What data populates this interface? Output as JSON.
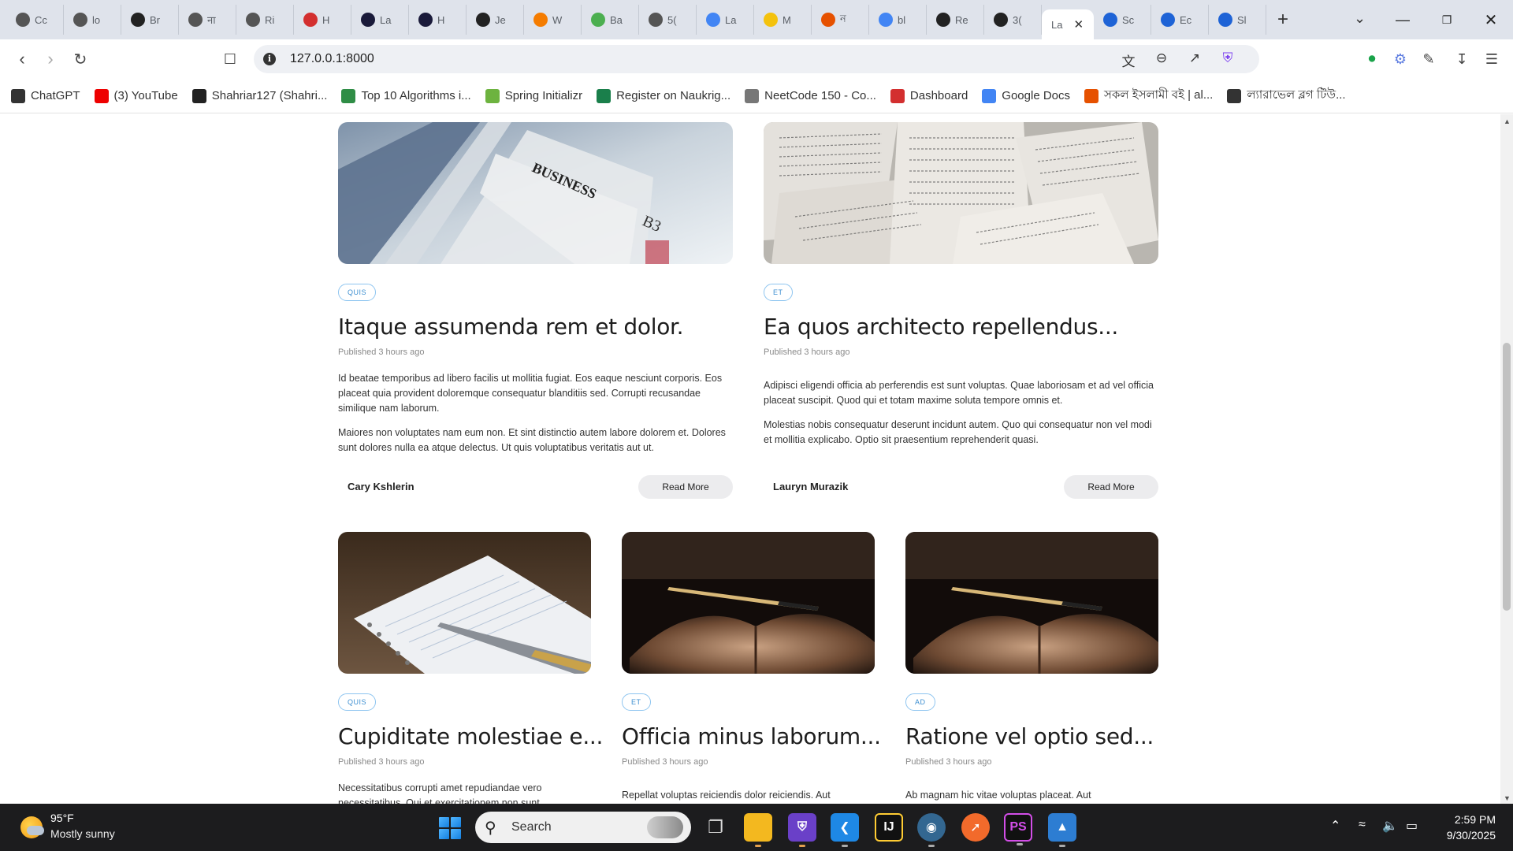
{
  "browser": {
    "tabs": [
      {
        "title": "Cc",
        "icon": "chatgpt-icon",
        "color": "#555"
      },
      {
        "title": "lo",
        "icon": "openai-icon",
        "color": "#555"
      },
      {
        "title": "Br",
        "icon": "github-icon",
        "color": "#222"
      },
      {
        "title": "ना",
        "icon": "chatgpt-icon",
        "color": "#555"
      },
      {
        "title": "Ri",
        "icon": "chatgpt-icon",
        "color": "#555"
      },
      {
        "title": "H",
        "icon": "nsu-icon",
        "color": "#d32f2f"
      },
      {
        "title": "La",
        "icon": "atcoder-icon",
        "color": "#1a1a3a"
      },
      {
        "title": "H",
        "icon": "atcoder-icon",
        "color": "#1a1a3a"
      },
      {
        "title": "Je",
        "icon": "github-icon",
        "color": "#222"
      },
      {
        "title": "W",
        "icon": "diamond-icon",
        "color": "#f57c00"
      },
      {
        "title": "Ba",
        "icon": "translate-icon",
        "color": "#4caf50"
      },
      {
        "title": "5(",
        "icon": "chatgpt-icon",
        "color": "#555"
      },
      {
        "title": "La",
        "icon": "docs-icon",
        "color": "#4285f4"
      },
      {
        "title": "M",
        "icon": "coin-icon",
        "color": "#f4c20d"
      },
      {
        "title": "ন",
        "icon": "a-icon",
        "color": "#e65100"
      },
      {
        "title": "bl",
        "icon": "google-icon",
        "color": "#4285f4"
      },
      {
        "title": "Re",
        "icon": "puzzle-icon",
        "color": "#222"
      },
      {
        "title": "3(",
        "icon": "is-icon",
        "color": "#222"
      },
      {
        "title": "La",
        "icon": "active-page-icon",
        "color": "#fff",
        "active": true
      },
      {
        "title": "Sc",
        "icon": "forms-icon",
        "color": "#1e63d6"
      },
      {
        "title": "Ec",
        "icon": "forms-icon",
        "color": "#1e63d6"
      },
      {
        "title": "Sl",
        "icon": "forms-icon",
        "color": "#1e63d6"
      }
    ],
    "url": "127.0.0.1:8000",
    "bookmarks": [
      {
        "label": "ChatGPT",
        "icon": "chatgpt-icon",
        "color": "#333"
      },
      {
        "label": "(3) YouTube",
        "icon": "youtube-icon",
        "color": "#e00"
      },
      {
        "label": "Shahriar127 (Shahri...",
        "icon": "github-icon",
        "color": "#222"
      },
      {
        "label": "Top 10 Algorithms i...",
        "icon": "gfg-icon",
        "color": "#2f8d46"
      },
      {
        "label": "Spring Initializr",
        "icon": "spring-icon",
        "color": "#6db33f"
      },
      {
        "label": "Register on Naukrig...",
        "icon": "naukri-icon",
        "color": "#1a7f4b"
      },
      {
        "label": "NeetCode 150 - Co...",
        "icon": "rocket-icon",
        "color": "#777"
      },
      {
        "label": "Dashboard",
        "icon": "dashboard-icon",
        "color": "#d32f2f"
      },
      {
        "label": "Google Docs",
        "icon": "docs-icon",
        "color": "#4285f4"
      },
      {
        "label": "সকল ইসলামী বই | al...",
        "icon": "a-icon",
        "color": "#e65100"
      },
      {
        "label": "ল্যারাভেল ব্লগ টিউ...",
        "icon": "chatgpt-icon",
        "color": "#333"
      }
    ]
  },
  "posts": [
    {
      "tag": "QUIS",
      "title": "Itaque assumenda rem et dolor.",
      "published": "Published 3 hours ago",
      "paragraphs": [
        "Id beatae temporibus ad libero facilis ut mollitia fugiat. Eos eaque nesciunt corporis. Eos placeat quia provident doloremque consequatur blanditiis sed. Corrupti recusandae similique nam laborum.",
        "Maiores non voluptates nam eum non. Et sint distinctio autem labore dolorem et. Dolores sunt dolores nulla ea atque delectus. Ut quis voluptatibus veritatis aut ut."
      ],
      "author": "Cary Kshlerin",
      "read_more": "Read More",
      "image": "newspaper-image"
    },
    {
      "tag": "ET",
      "title": "Ea quos architecto repellendus...",
      "published": "Published 3 hours ago",
      "paragraphs": [
        "Adipisci eligendi officia ab perferendis est sunt voluptas. Quae laboriosam et ad vel officia placeat suscipit. Quod qui et totam maxime soluta tempore omnis et.",
        "Molestias nobis consequatur deserunt incidunt autem. Quo qui consequatur non vel modi et mollitia explicabo. Optio sit praesentium reprehenderit quasi."
      ],
      "author": "Lauryn Murazik",
      "read_more": "Read More",
      "image": "old-pages-image"
    },
    {
      "tag": "QUIS",
      "title": "Cupiditate molestiae e...",
      "published": "Published 3 hours ago",
      "paragraphs": [
        "Necessitatibus corrupti amet repudiandae vero necessitatibus. Qui et exercitationem non sunt"
      ],
      "image": "notebook-pen-image"
    },
    {
      "tag": "ET",
      "title": "Officia minus laborum...",
      "published": "Published 3 hours ago",
      "paragraphs": [
        "Repellat voluptas reiciendis dolor reiciendis. Aut"
      ],
      "image": "open-book-pen-image"
    },
    {
      "tag": "AD",
      "title": "Ratione vel optio sed...",
      "published": "Published 3 hours ago",
      "paragraphs": [
        "Ab magnam hic vitae voluptas placeat. Aut"
      ],
      "image": "open-book-pen-image"
    }
  ],
  "taskbar": {
    "weather_temp": "95°F",
    "weather_desc": "Mostly sunny",
    "search_label": "Search",
    "time": "2:59 PM",
    "date": "9/30/2025"
  }
}
